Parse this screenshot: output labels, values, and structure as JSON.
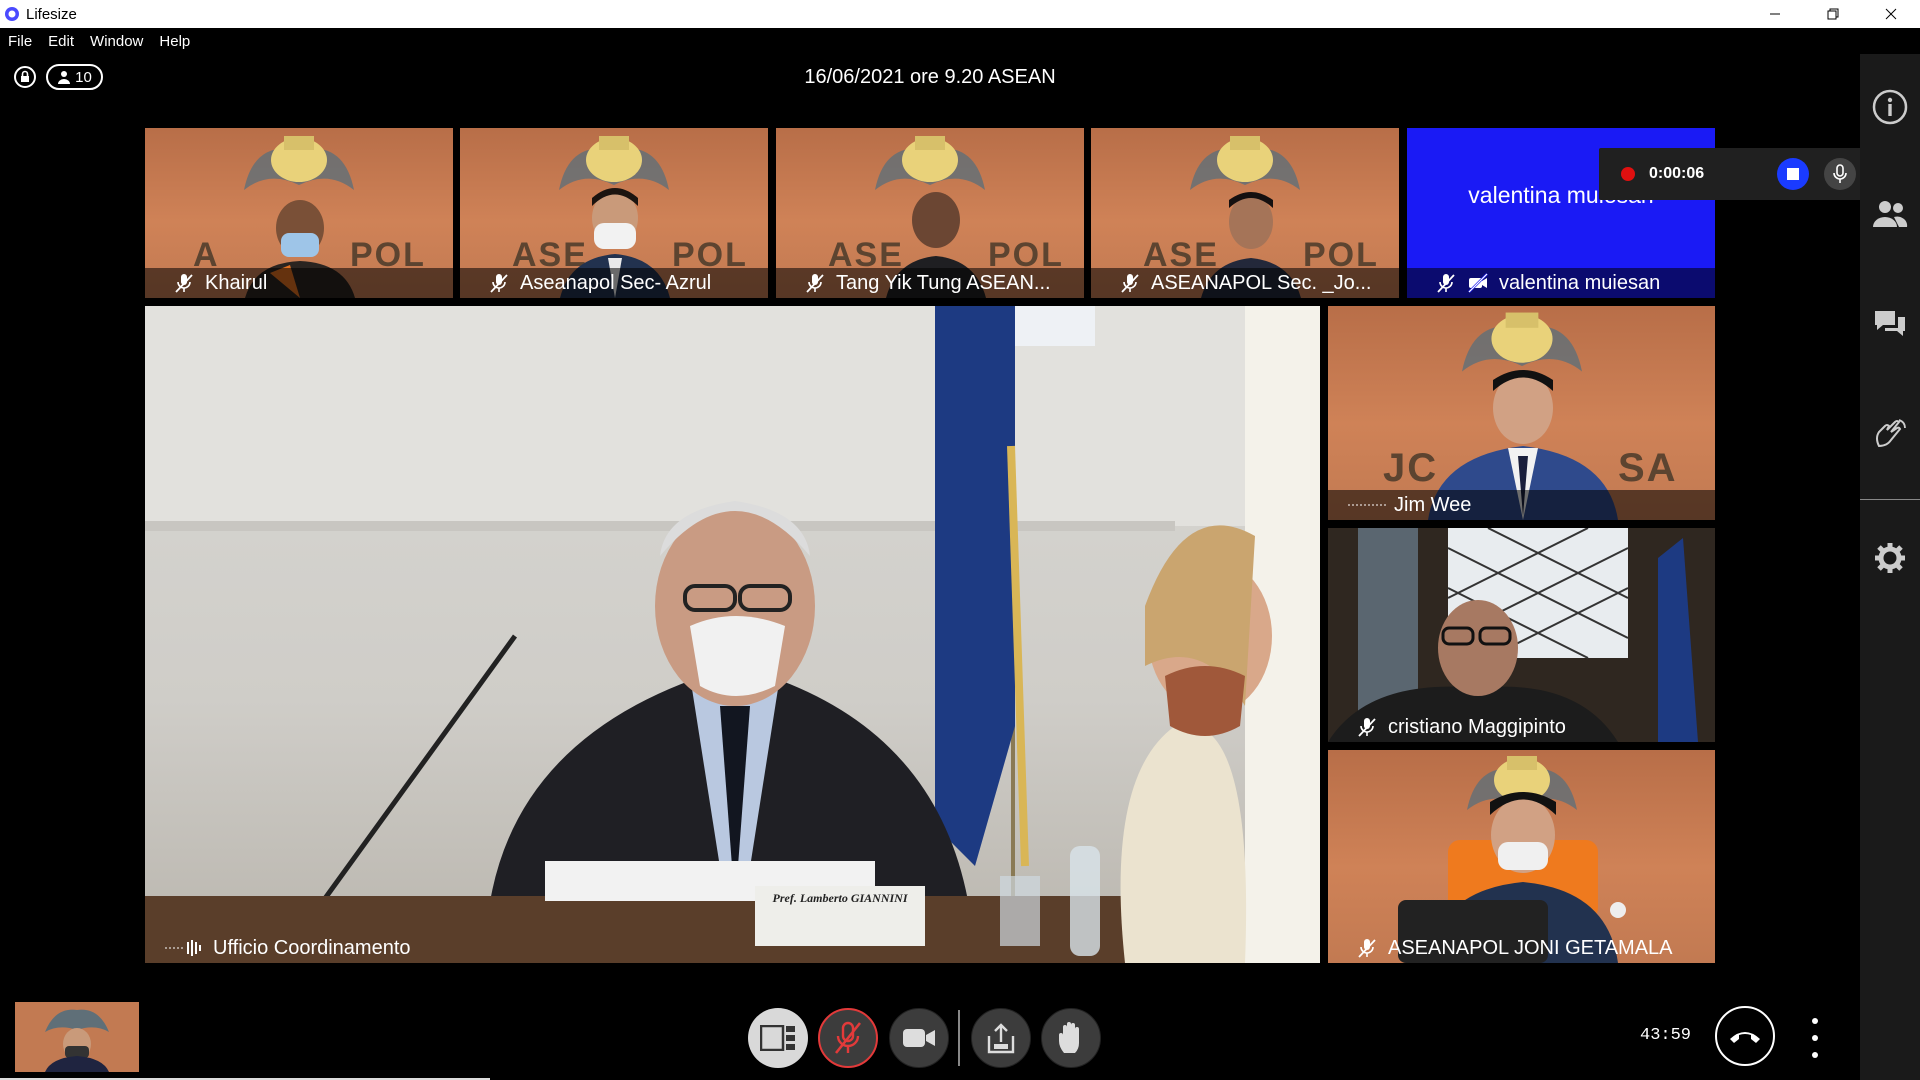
{
  "window": {
    "title": "Lifesize",
    "menu": [
      "File",
      "Edit",
      "Window",
      "Help"
    ]
  },
  "meeting": {
    "title": "16/06/2021 ore 9.20 ASEAN",
    "participant_count": "10",
    "elapsed": "43:59"
  },
  "recording": {
    "time": "0:00:06"
  },
  "tiles": {
    "top": [
      {
        "name": "Khairul",
        "muted": true
      },
      {
        "name": "Aseanapol Sec- Azrul",
        "muted": true
      },
      {
        "name": "Tang Yik Tung ASEAN...",
        "muted": true
      },
      {
        "name": "ASEANAPOL Sec. _Jo...",
        "muted": true
      },
      {
        "name": "valentina muiesan",
        "big_text": "valentina muiesan",
        "muted": true,
        "video_off": true
      }
    ],
    "main": {
      "name": "Ufficio Coordinamento",
      "nameplate_card": "Pref. Lamberto GIANNINI",
      "speaking": true
    },
    "side": [
      {
        "name": "Jim Wee",
        "speaking": true
      },
      {
        "name": "cristiano Maggipinto",
        "muted": true
      },
      {
        "name": "ASEANAPOL JONI GETAMALA",
        "muted": true
      }
    ],
    "logo_text": "ASEANAPOL"
  },
  "colors": {
    "accent_blue": "#1a3bff",
    "record_red": "#e01010",
    "tile_orange": "#c9794f",
    "mute_red": "#e23a3a"
  }
}
